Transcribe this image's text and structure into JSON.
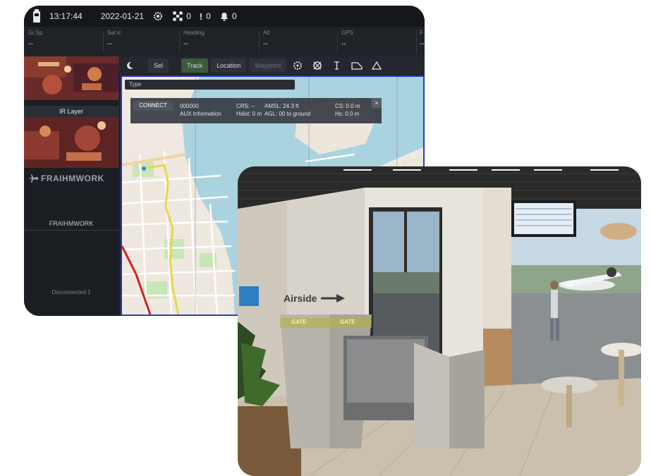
{
  "topbar": {
    "time": "13:17:44",
    "date": "2022-01-21",
    "status_count_1": "0",
    "status_count_2": "0",
    "status_count_3": "0"
  },
  "status_row": [
    {
      "label": "Gr.Sp",
      "value": "--"
    },
    {
      "label": "Sat.ic",
      "value": "--"
    },
    {
      "label": "Heading",
      "value": "--"
    },
    {
      "label": "Alt",
      "value": "--"
    },
    {
      "label": "GPS",
      "value": "--"
    },
    {
      "label": "F",
      "value": "--"
    }
  ],
  "sidebar": {
    "thumb1_label": "IR Layer",
    "brand_name": "FRAIHMWORK",
    "brand_sub": "FRAIHMWORK",
    "footer": "Disconnected 1"
  },
  "toolbar": {
    "btn_1": "Sel",
    "btn_2": "Track",
    "btn_3": "Location",
    "btn_4": "Waypoint"
  },
  "map": {
    "search_placeholder": "Type",
    "info_button": "CONNECT",
    "info_col1_line1": "000000",
    "info_col1_line2": "AUX Information",
    "info_col2_line1": "CRS: --",
    "info_col2_line2": "Hdist: 0 m",
    "info_col3_line1": "AMSL: 24.3 ft",
    "info_col3_line2": "AGL: 00 to ground",
    "info_col4_line1": "CS: 0.0 m",
    "info_col4_line2": "Hs: 0.0 m",
    "close": "×"
  },
  "photo": {
    "airside_label": "Airside",
    "gate_label_1": "GATE",
    "gate_label_2": "GATE"
  },
  "colors": {
    "panel_bg": "#1a1d22",
    "map_border": "#2b3cc6",
    "route_red": "#d21f1f",
    "route_yellow": "#e8d64a",
    "water": "#a9d3df"
  }
}
